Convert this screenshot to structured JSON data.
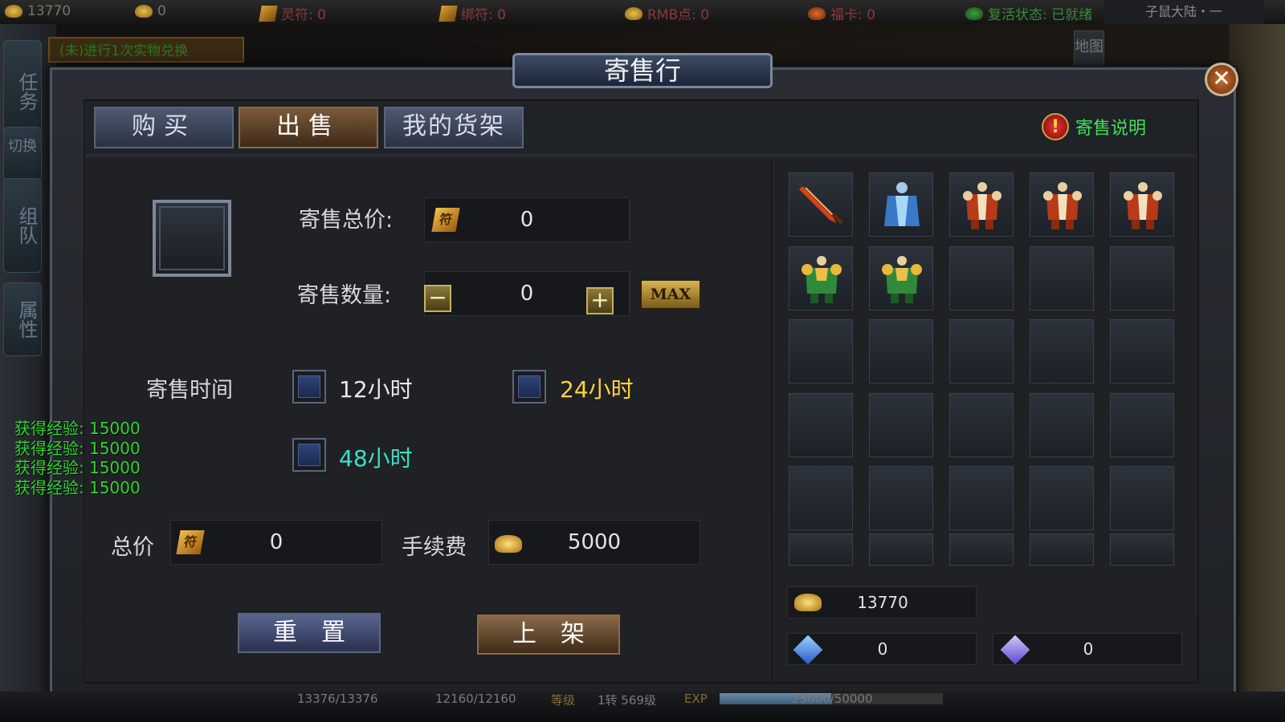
{
  "topbar": {
    "gold": "13770",
    "bound_gold": "0",
    "lingfu": "灵符: 0",
    "bangfu": "绑符: 0",
    "rmb": "RMB点: 0",
    "fuka": "福卡: 0",
    "revive": "复活状态: 已就绪",
    "region": "子鼠大陆・一"
  },
  "side": {
    "quest": "任务",
    "switch": "切换",
    "team": "组队",
    "attr": "属性",
    "map": "地图"
  },
  "quest_hint": "(未)进行1次实物兑换",
  "exp_log": [
    "获得经验: 15000",
    "获得经验: 15000",
    "获得经验: 15000",
    "获得经验: 15000"
  ],
  "window": {
    "title": "寄售行",
    "close": "✕",
    "tabs": [
      {
        "label": "购买"
      },
      {
        "label": "出售"
      },
      {
        "label": "我的货架"
      }
    ],
    "help": {
      "icon": "!",
      "label": "寄售说明"
    }
  },
  "sell": {
    "total_price_label": "寄售总价:",
    "total_price_value": "0",
    "quantity_label": "寄售数量:",
    "quantity_value": "0",
    "minus": "−",
    "plus": "+",
    "max": "MAX",
    "time_label": "寄售时间",
    "options": [
      {
        "label": "12小时",
        "color": "#e8e8e8"
      },
      {
        "label": "24小时",
        "color": "#ffd43a"
      },
      {
        "label": "48小时",
        "color": "#3ae0c8"
      }
    ],
    "summary_label": "总价",
    "summary_value": "0",
    "fee_label": "手续费",
    "fee_value": "5000",
    "reset_button": "重置",
    "list_button": "上架",
    "fu_glyph": "符"
  },
  "inventory": {
    "items": [
      "red-sword",
      "blue-robe",
      "red-armor",
      "red-armor",
      "red-armor",
      "green-armor",
      "green-armor"
    ],
    "rows": 6,
    "cols": 5
  },
  "currency": {
    "gold": "13770",
    "gem": "0",
    "bound_gem": "0"
  },
  "bottombar": {
    "hp": "13376/13376",
    "mp": "12160/12160",
    "level_label": "等级",
    "level": "1转 569级",
    "exp_label": "EXP",
    "exp": "25000/50000",
    "exp_fraction": 0.5
  }
}
